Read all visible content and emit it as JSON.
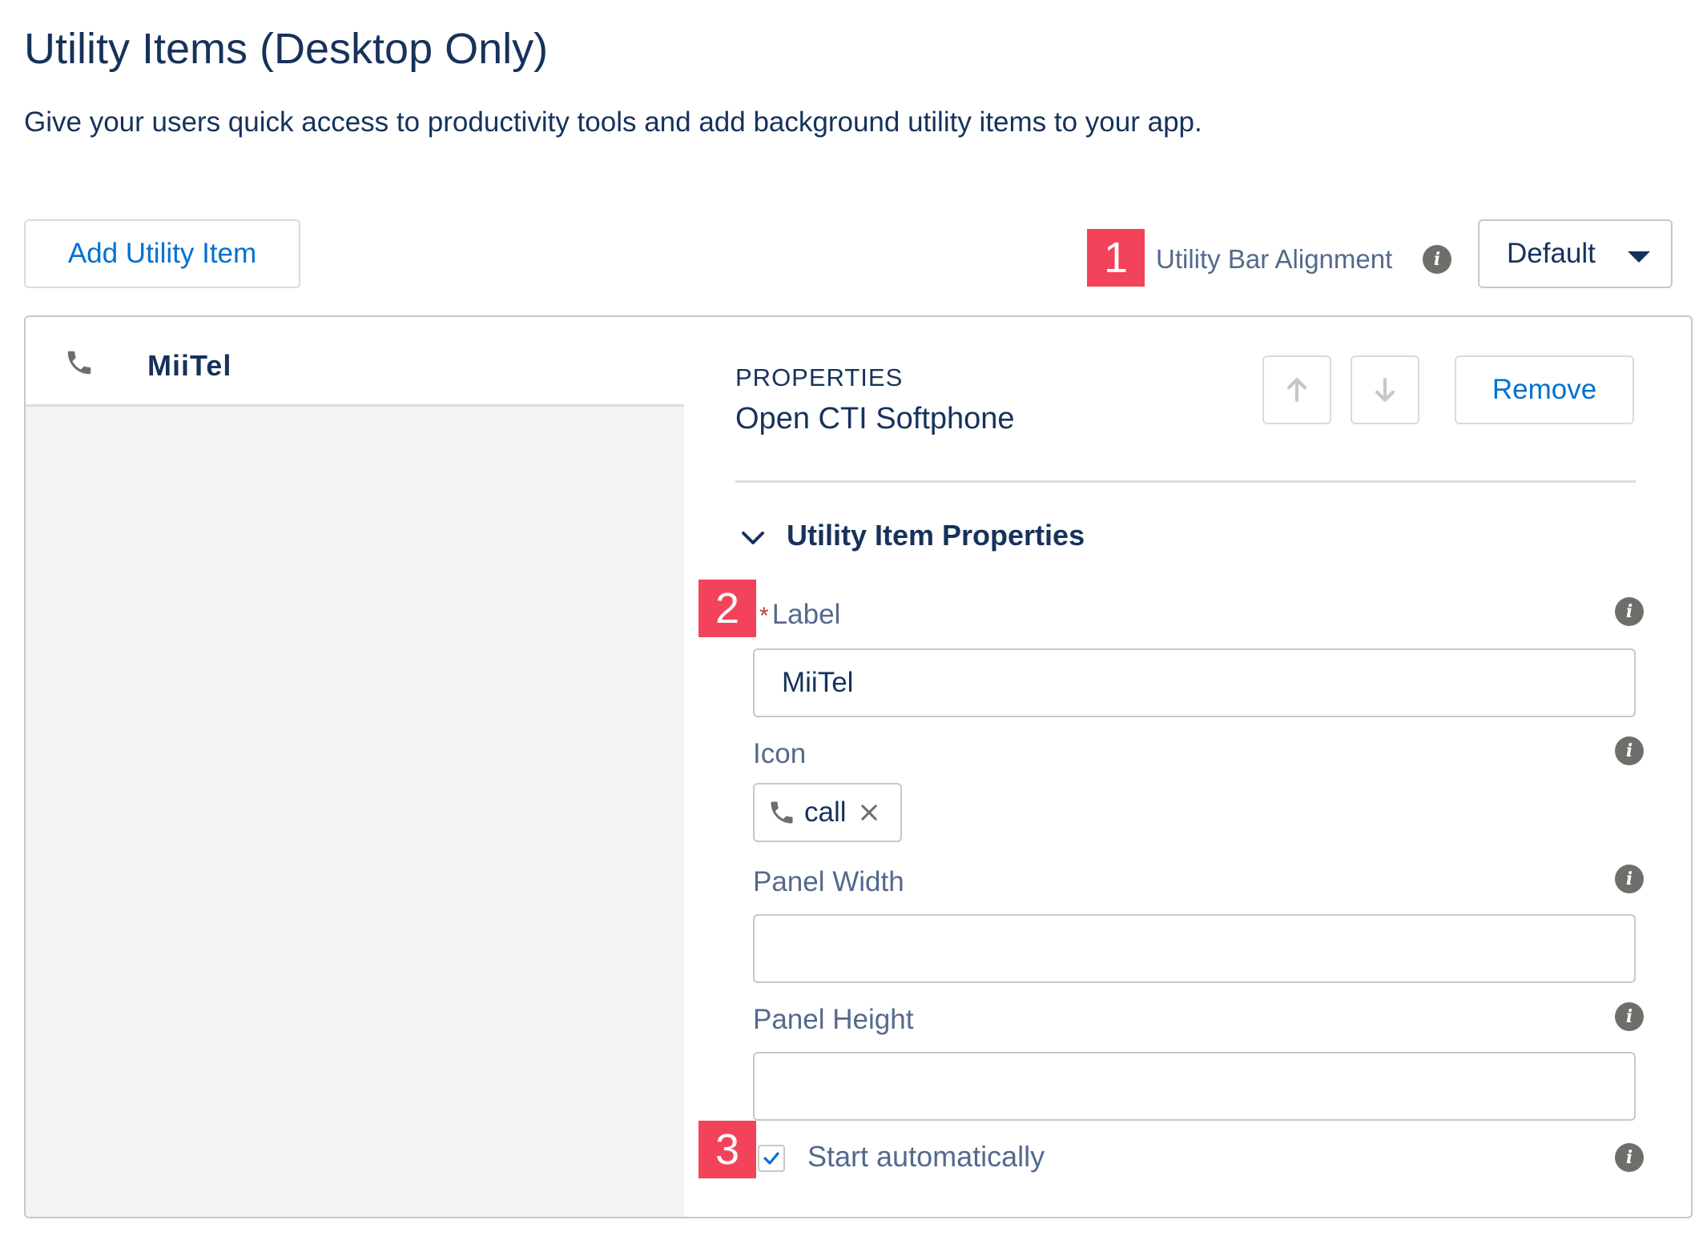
{
  "header": {
    "title": "Utility Items (Desktop Only)",
    "description": "Give your users quick access to productivity tools and add background utility items to your app."
  },
  "toolbar": {
    "add_button_label": "Add Utility Item",
    "alignment_label": "Utility Bar Alignment",
    "alignment_value": "Default"
  },
  "markers": [
    "1",
    "2",
    "3"
  ],
  "utility_items": [
    {
      "label": "MiiTel",
      "icon": "phone-icon"
    }
  ],
  "properties": {
    "heading": "PROPERTIES",
    "type": "Open CTI Softphone",
    "up_icon": "arrow-up-icon",
    "down_icon": "arrow-down-icon",
    "remove_label": "Remove",
    "section_title": "Utility Item Properties",
    "fields": {
      "label": {
        "label": "Label",
        "required_mark": "*",
        "value": "MiiTel"
      },
      "icon": {
        "label": "Icon",
        "value": "call",
        "icon": "phone-icon"
      },
      "panel_width": {
        "label": "Panel Width",
        "value": ""
      },
      "panel_height": {
        "label": "Panel Height",
        "value": ""
      },
      "start_automatically": {
        "label": "Start automatically",
        "checked": true
      }
    }
  },
  "colors": {
    "accent": "#0070d2",
    "marker": "#f2435a",
    "text": "#16325c",
    "muted": "#54698d"
  }
}
